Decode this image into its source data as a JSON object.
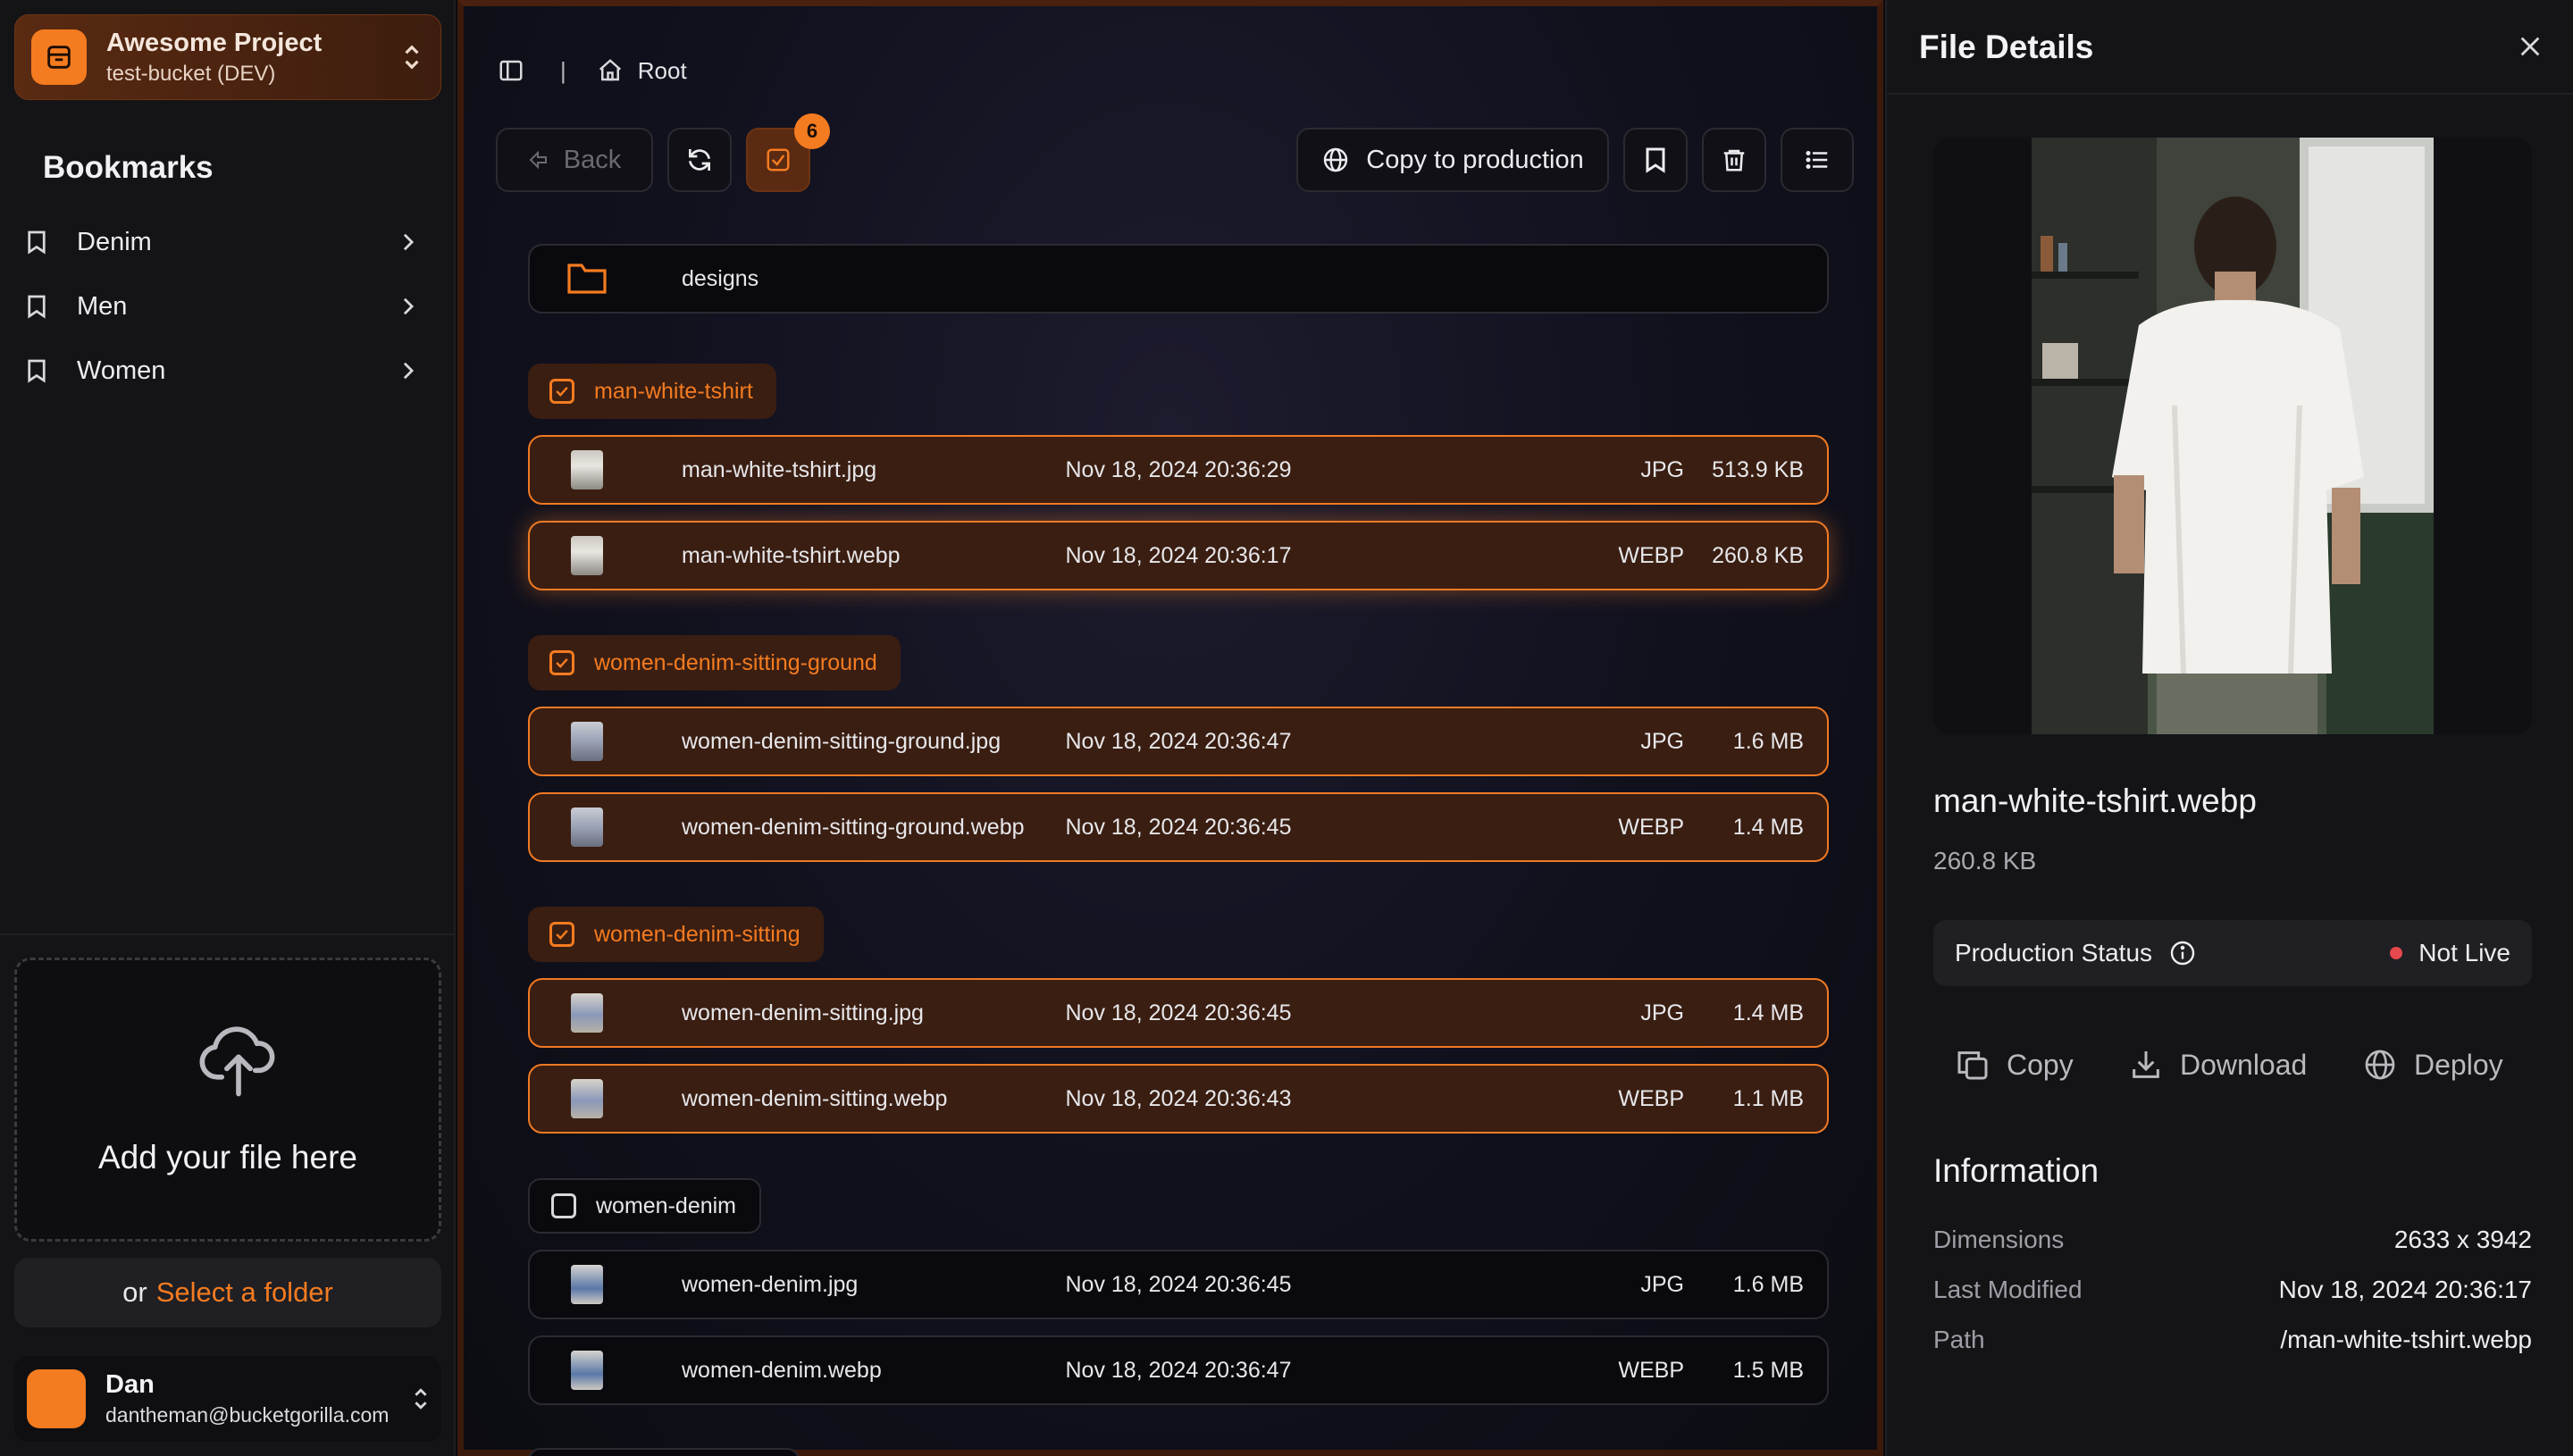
{
  "project": {
    "name": "Awesome Project",
    "bucket": "test-bucket (DEV)"
  },
  "sidebar": {
    "bookmarks_title": "Bookmarks",
    "bookmarks": [
      {
        "label": "Denim"
      },
      {
        "label": "Men"
      },
      {
        "label": "Women"
      }
    ],
    "upload_text": "Add your file here",
    "select_prefix": "or",
    "select_link": "Select a folder"
  },
  "user": {
    "name": "Dan",
    "email": "dantheman@bucketgorilla.com"
  },
  "breadcrumb": {
    "separator": "|",
    "root": "Root"
  },
  "toolbar": {
    "back": "Back",
    "selected_count": "6",
    "copy_to_production": "Copy to production"
  },
  "folder": {
    "name": "designs"
  },
  "groups": [
    {
      "name": "man-white-tshirt",
      "checked": true,
      "files": [
        {
          "name": "man-white-tshirt.jpg",
          "date": "Nov 18, 2024 20:36:29",
          "type": "JPG",
          "size": "513.9 KB"
        },
        {
          "name": "man-white-tshirt.webp",
          "date": "Nov 18, 2024 20:36:17",
          "type": "WEBP",
          "size": "260.8 KB"
        }
      ]
    },
    {
      "name": "women-denim-sitting-ground",
      "checked": true,
      "files": [
        {
          "name": "women-denim-sitting-ground.jpg",
          "date": "Nov 18, 2024 20:36:47",
          "type": "JPG",
          "size": "1.6 MB"
        },
        {
          "name": "women-denim-sitting-ground.webp",
          "date": "Nov 18, 2024 20:36:45",
          "type": "WEBP",
          "size": "1.4 MB"
        }
      ]
    },
    {
      "name": "women-denim-sitting",
      "checked": true,
      "files": [
        {
          "name": "women-denim-sitting.jpg",
          "date": "Nov 18, 2024 20:36:45",
          "type": "JPG",
          "size": "1.4 MB"
        },
        {
          "name": "women-denim-sitting.webp",
          "date": "Nov 18, 2024 20:36:43",
          "type": "WEBP",
          "size": "1.1 MB"
        }
      ]
    },
    {
      "name": "women-denim",
      "checked": false,
      "files": [
        {
          "name": "women-denim.jpg",
          "date": "Nov 18, 2024 20:36:45",
          "type": "JPG",
          "size": "1.6 MB"
        },
        {
          "name": "women-denim.webp",
          "date": "Nov 18, 2024 20:36:47",
          "type": "WEBP",
          "size": "1.5 MB"
        }
      ]
    }
  ],
  "details": {
    "title": "File Details",
    "file_name": "man-white-tshirt.webp",
    "file_size": "260.8 KB",
    "status_label": "Production Status",
    "status_value": "Not Live",
    "actions": {
      "copy": "Copy",
      "download": "Download",
      "deploy": "Deploy"
    },
    "info_title": "Information",
    "info": [
      {
        "key": "Dimensions",
        "value": "2633 x 3942"
      },
      {
        "key": "Last Modified",
        "value": "Nov 18, 2024 20:36:17"
      },
      {
        "key": "Path",
        "value": "/man-white-tshirt.webp"
      }
    ]
  },
  "colors": {
    "accent": "#f47b20",
    "status_not_live": "#e5484d",
    "selected_row_bg": "#3a1e12"
  }
}
